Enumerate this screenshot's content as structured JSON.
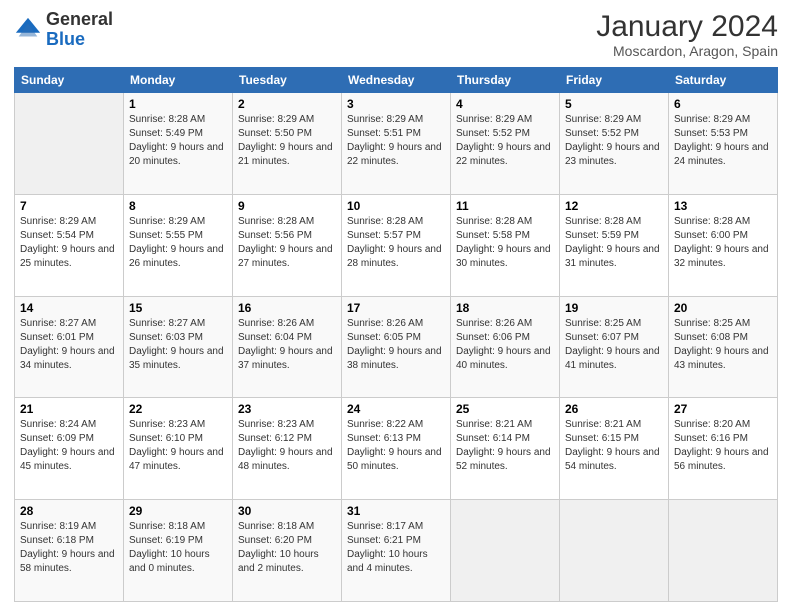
{
  "header": {
    "logo_general": "General",
    "logo_blue": "Blue",
    "month_title": "January 2024",
    "location": "Moscardon, Aragon, Spain"
  },
  "weekdays": [
    "Sunday",
    "Monday",
    "Tuesday",
    "Wednesday",
    "Thursday",
    "Friday",
    "Saturday"
  ],
  "weeks": [
    [
      {
        "day": "",
        "sunrise": "",
        "sunset": "",
        "daylight": "",
        "empty": true
      },
      {
        "day": "1",
        "sunrise": "Sunrise: 8:28 AM",
        "sunset": "Sunset: 5:49 PM",
        "daylight": "Daylight: 9 hours and 20 minutes."
      },
      {
        "day": "2",
        "sunrise": "Sunrise: 8:29 AM",
        "sunset": "Sunset: 5:50 PM",
        "daylight": "Daylight: 9 hours and 21 minutes."
      },
      {
        "day": "3",
        "sunrise": "Sunrise: 8:29 AM",
        "sunset": "Sunset: 5:51 PM",
        "daylight": "Daylight: 9 hours and 22 minutes."
      },
      {
        "day": "4",
        "sunrise": "Sunrise: 8:29 AM",
        "sunset": "Sunset: 5:52 PM",
        "daylight": "Daylight: 9 hours and 22 minutes."
      },
      {
        "day": "5",
        "sunrise": "Sunrise: 8:29 AM",
        "sunset": "Sunset: 5:52 PM",
        "daylight": "Daylight: 9 hours and 23 minutes."
      },
      {
        "day": "6",
        "sunrise": "Sunrise: 8:29 AM",
        "sunset": "Sunset: 5:53 PM",
        "daylight": "Daylight: 9 hours and 24 minutes."
      }
    ],
    [
      {
        "day": "7",
        "sunrise": "Sunrise: 8:29 AM",
        "sunset": "Sunset: 5:54 PM",
        "daylight": "Daylight: 9 hours and 25 minutes."
      },
      {
        "day": "8",
        "sunrise": "Sunrise: 8:29 AM",
        "sunset": "Sunset: 5:55 PM",
        "daylight": "Daylight: 9 hours and 26 minutes."
      },
      {
        "day": "9",
        "sunrise": "Sunrise: 8:28 AM",
        "sunset": "Sunset: 5:56 PM",
        "daylight": "Daylight: 9 hours and 27 minutes."
      },
      {
        "day": "10",
        "sunrise": "Sunrise: 8:28 AM",
        "sunset": "Sunset: 5:57 PM",
        "daylight": "Daylight: 9 hours and 28 minutes."
      },
      {
        "day": "11",
        "sunrise": "Sunrise: 8:28 AM",
        "sunset": "Sunset: 5:58 PM",
        "daylight": "Daylight: 9 hours and 30 minutes."
      },
      {
        "day": "12",
        "sunrise": "Sunrise: 8:28 AM",
        "sunset": "Sunset: 5:59 PM",
        "daylight": "Daylight: 9 hours and 31 minutes."
      },
      {
        "day": "13",
        "sunrise": "Sunrise: 8:28 AM",
        "sunset": "Sunset: 6:00 PM",
        "daylight": "Daylight: 9 hours and 32 minutes."
      }
    ],
    [
      {
        "day": "14",
        "sunrise": "Sunrise: 8:27 AM",
        "sunset": "Sunset: 6:01 PM",
        "daylight": "Daylight: 9 hours and 34 minutes."
      },
      {
        "day": "15",
        "sunrise": "Sunrise: 8:27 AM",
        "sunset": "Sunset: 6:03 PM",
        "daylight": "Daylight: 9 hours and 35 minutes."
      },
      {
        "day": "16",
        "sunrise": "Sunrise: 8:26 AM",
        "sunset": "Sunset: 6:04 PM",
        "daylight": "Daylight: 9 hours and 37 minutes."
      },
      {
        "day": "17",
        "sunrise": "Sunrise: 8:26 AM",
        "sunset": "Sunset: 6:05 PM",
        "daylight": "Daylight: 9 hours and 38 minutes."
      },
      {
        "day": "18",
        "sunrise": "Sunrise: 8:26 AM",
        "sunset": "Sunset: 6:06 PM",
        "daylight": "Daylight: 9 hours and 40 minutes."
      },
      {
        "day": "19",
        "sunrise": "Sunrise: 8:25 AM",
        "sunset": "Sunset: 6:07 PM",
        "daylight": "Daylight: 9 hours and 41 minutes."
      },
      {
        "day": "20",
        "sunrise": "Sunrise: 8:25 AM",
        "sunset": "Sunset: 6:08 PM",
        "daylight": "Daylight: 9 hours and 43 minutes."
      }
    ],
    [
      {
        "day": "21",
        "sunrise": "Sunrise: 8:24 AM",
        "sunset": "Sunset: 6:09 PM",
        "daylight": "Daylight: 9 hours and 45 minutes."
      },
      {
        "day": "22",
        "sunrise": "Sunrise: 8:23 AM",
        "sunset": "Sunset: 6:10 PM",
        "daylight": "Daylight: 9 hours and 47 minutes."
      },
      {
        "day": "23",
        "sunrise": "Sunrise: 8:23 AM",
        "sunset": "Sunset: 6:12 PM",
        "daylight": "Daylight: 9 hours and 48 minutes."
      },
      {
        "day": "24",
        "sunrise": "Sunrise: 8:22 AM",
        "sunset": "Sunset: 6:13 PM",
        "daylight": "Daylight: 9 hours and 50 minutes."
      },
      {
        "day": "25",
        "sunrise": "Sunrise: 8:21 AM",
        "sunset": "Sunset: 6:14 PM",
        "daylight": "Daylight: 9 hours and 52 minutes."
      },
      {
        "day": "26",
        "sunrise": "Sunrise: 8:21 AM",
        "sunset": "Sunset: 6:15 PM",
        "daylight": "Daylight: 9 hours and 54 minutes."
      },
      {
        "day": "27",
        "sunrise": "Sunrise: 8:20 AM",
        "sunset": "Sunset: 6:16 PM",
        "daylight": "Daylight: 9 hours and 56 minutes."
      }
    ],
    [
      {
        "day": "28",
        "sunrise": "Sunrise: 8:19 AM",
        "sunset": "Sunset: 6:18 PM",
        "daylight": "Daylight: 9 hours and 58 minutes."
      },
      {
        "day": "29",
        "sunrise": "Sunrise: 8:18 AM",
        "sunset": "Sunset: 6:19 PM",
        "daylight": "Daylight: 10 hours and 0 minutes."
      },
      {
        "day": "30",
        "sunrise": "Sunrise: 8:18 AM",
        "sunset": "Sunset: 6:20 PM",
        "daylight": "Daylight: 10 hours and 2 minutes."
      },
      {
        "day": "31",
        "sunrise": "Sunrise: 8:17 AM",
        "sunset": "Sunset: 6:21 PM",
        "daylight": "Daylight: 10 hours and 4 minutes."
      },
      {
        "day": "",
        "sunrise": "",
        "sunset": "",
        "daylight": "",
        "empty": true
      },
      {
        "day": "",
        "sunrise": "",
        "sunset": "",
        "daylight": "",
        "empty": true
      },
      {
        "day": "",
        "sunrise": "",
        "sunset": "",
        "daylight": "",
        "empty": true
      }
    ]
  ]
}
